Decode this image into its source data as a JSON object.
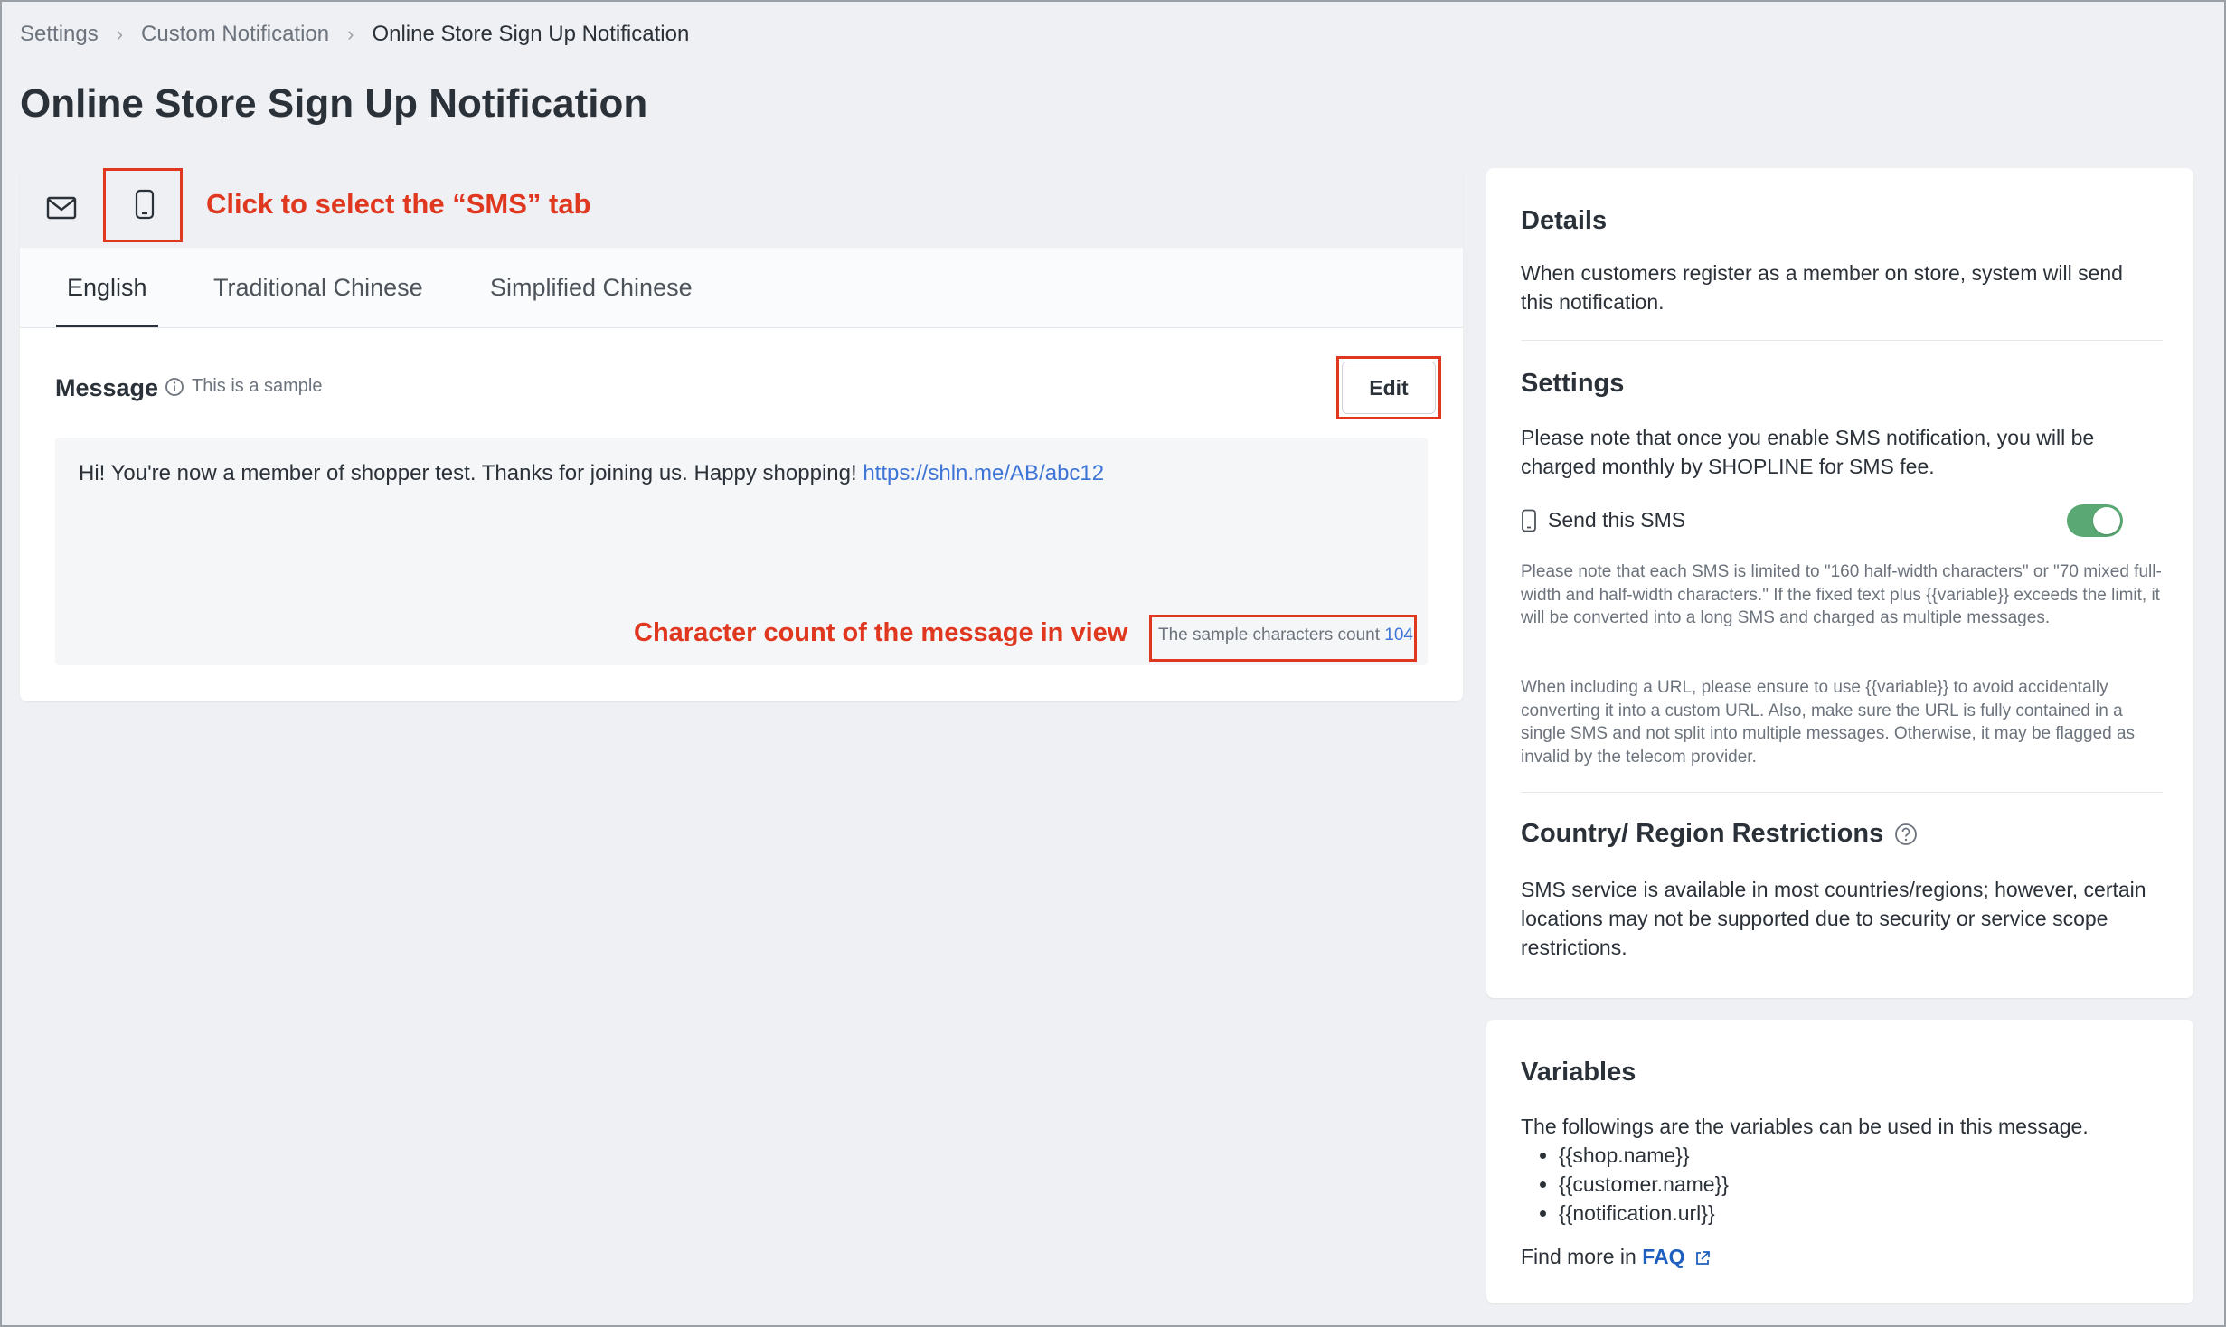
{
  "breadcrumb": {
    "items": [
      "Settings",
      "Custom Notification"
    ],
    "current": "Online Store Sign Up Notification"
  },
  "page_title": "Online Store Sign Up Notification",
  "channel_tabs": {
    "email_icon": "mail-icon",
    "sms_icon": "phone-icon",
    "selected": "sms"
  },
  "annotations": {
    "sms_tab": "Click to select the “SMS” tab",
    "char_count": "Character count of the message in view"
  },
  "language_tabs": [
    "English",
    "Traditional Chinese",
    "Simplified Chinese"
  ],
  "active_language": "English",
  "message": {
    "label": "Message",
    "info": "This is a sample",
    "edit_label": "Edit",
    "body_text": "Hi! You're now a member of shopper test. Thanks for joining us. Happy shopping! ",
    "link": "https://shln.me/AB/abc12",
    "count_label": "The sample characters count",
    "count_value": "104"
  },
  "details": {
    "title": "Details",
    "text": "When customers register as a member on store, system will send this notification."
  },
  "settings": {
    "title": "Settings",
    "text": "Please note that once you enable SMS notification, you will be charged monthly by SHOPLINE for SMS fee.",
    "send_label": "Send this SMS",
    "send_enabled": true,
    "note1": "Please note that each SMS is limited to \"160 half-width characters\" or \"70 mixed full-width and half-width characters.\" If the fixed text plus {{variable}} exceeds the limit, it will be converted into a long SMS and charged as multiple messages.",
    "note2": "When including a URL, please ensure to use {{variable}} to avoid accidentally converting it into a custom URL. Also, make sure the URL is fully contained in a single SMS and not split into multiple messages. Otherwise, it may be flagged as invalid by the telecom provider."
  },
  "restrictions": {
    "title": "Country/ Region Restrictions",
    "text": "SMS service is available in most countries/regions; however, certain locations may not be supported due to security or service scope restrictions."
  },
  "variables": {
    "title": "Variables",
    "intro": "The followings are the variables can be used in this message.",
    "items": [
      "{{shop.name}}",
      "{{customer.name}}",
      "{{notification.url}}"
    ],
    "find_more": "Find more in ",
    "faq": "FAQ"
  },
  "colors": {
    "accent_red": "#e0371f",
    "link_blue": "#3d74d6",
    "toggle_green": "#5aa874"
  }
}
